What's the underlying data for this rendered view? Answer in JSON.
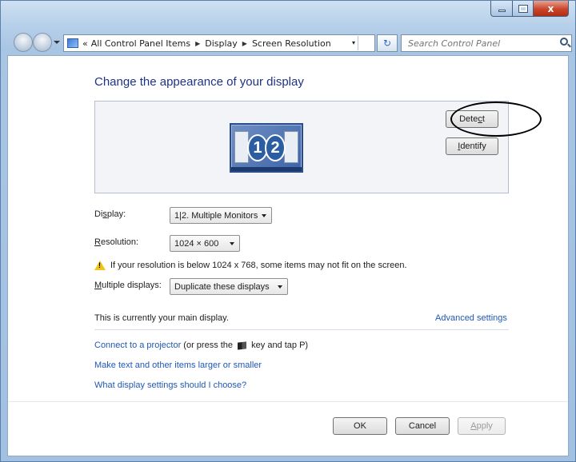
{
  "window": {
    "caption": {
      "minimize": "",
      "maximize": "",
      "close": "x"
    }
  },
  "nav": {
    "breadcrumb_prefix": "«",
    "crumbs": [
      "All Control Panel Items",
      "Display",
      "Screen Resolution"
    ],
    "separator": "▶",
    "dropdown_arrow": "▾",
    "refresh_glyph": "↻",
    "search_placeholder": "Search Control Panel"
  },
  "main": {
    "heading": "Change the appearance of your display",
    "preview": {
      "monitor_numbers": [
        "1",
        "2"
      ],
      "detect": {
        "prefix": "Dete",
        "accel": "c",
        "suffix": "t"
      },
      "identify": {
        "accel": "I",
        "suffix": "dentify"
      }
    },
    "display": {
      "label_pre": "Di",
      "label_accel": "s",
      "label_post": "play:",
      "value": "1|2. Multiple Monitors"
    },
    "resolution": {
      "label_accel": "R",
      "label_post": "esolution:",
      "value": "1024 × 600"
    },
    "warning": "If your resolution is below 1024 x 768, some items may not fit on the screen.",
    "multiple": {
      "label_accel": "M",
      "label_post": "ultiple displays:",
      "value": "Duplicate these displays"
    },
    "main_display_text": "This is currently your main display.",
    "advanced_link": "Advanced settings",
    "projector_link": "Connect to a projector",
    "projector_pre": " (or press the ",
    "projector_post": " key and tap P)",
    "text_size_link": "Make text and other items larger or smaller",
    "help_link": "What display settings should I choose?"
  },
  "footer": {
    "ok": "OK",
    "cancel": "Cancel",
    "apply_accel": "A",
    "apply_post": "pply"
  },
  "colors": {
    "heading": "#1e3287",
    "link": "#1f58b6",
    "warning": "#f0c419"
  }
}
